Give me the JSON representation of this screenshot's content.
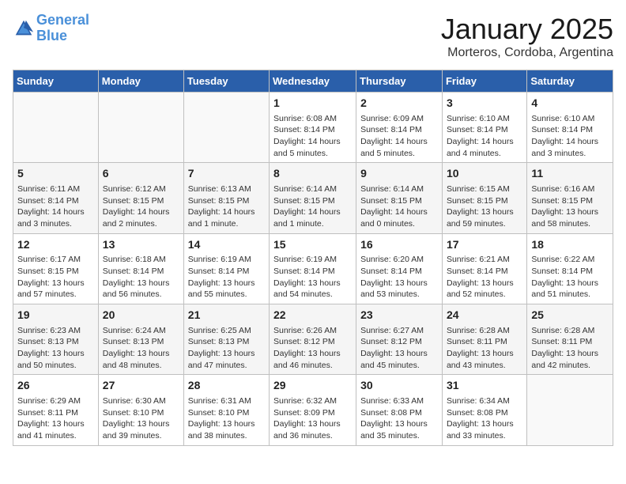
{
  "logo": {
    "line1": "General",
    "line2": "Blue"
  },
  "title": "January 2025",
  "subtitle": "Morteros, Cordoba, Argentina",
  "days_header": [
    "Sunday",
    "Monday",
    "Tuesday",
    "Wednesday",
    "Thursday",
    "Friday",
    "Saturday"
  ],
  "weeks": [
    [
      {
        "day": "",
        "info": ""
      },
      {
        "day": "",
        "info": ""
      },
      {
        "day": "",
        "info": ""
      },
      {
        "day": "1",
        "info": "Sunrise: 6:08 AM\nSunset: 8:14 PM\nDaylight: 14 hours\nand 5 minutes."
      },
      {
        "day": "2",
        "info": "Sunrise: 6:09 AM\nSunset: 8:14 PM\nDaylight: 14 hours\nand 5 minutes."
      },
      {
        "day": "3",
        "info": "Sunrise: 6:10 AM\nSunset: 8:14 PM\nDaylight: 14 hours\nand 4 minutes."
      },
      {
        "day": "4",
        "info": "Sunrise: 6:10 AM\nSunset: 8:14 PM\nDaylight: 14 hours\nand 3 minutes."
      }
    ],
    [
      {
        "day": "5",
        "info": "Sunrise: 6:11 AM\nSunset: 8:14 PM\nDaylight: 14 hours\nand 3 minutes."
      },
      {
        "day": "6",
        "info": "Sunrise: 6:12 AM\nSunset: 8:15 PM\nDaylight: 14 hours\nand 2 minutes."
      },
      {
        "day": "7",
        "info": "Sunrise: 6:13 AM\nSunset: 8:15 PM\nDaylight: 14 hours\nand 1 minute."
      },
      {
        "day": "8",
        "info": "Sunrise: 6:14 AM\nSunset: 8:15 PM\nDaylight: 14 hours\nand 1 minute."
      },
      {
        "day": "9",
        "info": "Sunrise: 6:14 AM\nSunset: 8:15 PM\nDaylight: 14 hours\nand 0 minutes."
      },
      {
        "day": "10",
        "info": "Sunrise: 6:15 AM\nSunset: 8:15 PM\nDaylight: 13 hours\nand 59 minutes."
      },
      {
        "day": "11",
        "info": "Sunrise: 6:16 AM\nSunset: 8:15 PM\nDaylight: 13 hours\nand 58 minutes."
      }
    ],
    [
      {
        "day": "12",
        "info": "Sunrise: 6:17 AM\nSunset: 8:15 PM\nDaylight: 13 hours\nand 57 minutes."
      },
      {
        "day": "13",
        "info": "Sunrise: 6:18 AM\nSunset: 8:14 PM\nDaylight: 13 hours\nand 56 minutes."
      },
      {
        "day": "14",
        "info": "Sunrise: 6:19 AM\nSunset: 8:14 PM\nDaylight: 13 hours\nand 55 minutes."
      },
      {
        "day": "15",
        "info": "Sunrise: 6:19 AM\nSunset: 8:14 PM\nDaylight: 13 hours\nand 54 minutes."
      },
      {
        "day": "16",
        "info": "Sunrise: 6:20 AM\nSunset: 8:14 PM\nDaylight: 13 hours\nand 53 minutes."
      },
      {
        "day": "17",
        "info": "Sunrise: 6:21 AM\nSunset: 8:14 PM\nDaylight: 13 hours\nand 52 minutes."
      },
      {
        "day": "18",
        "info": "Sunrise: 6:22 AM\nSunset: 8:14 PM\nDaylight: 13 hours\nand 51 minutes."
      }
    ],
    [
      {
        "day": "19",
        "info": "Sunrise: 6:23 AM\nSunset: 8:13 PM\nDaylight: 13 hours\nand 50 minutes."
      },
      {
        "day": "20",
        "info": "Sunrise: 6:24 AM\nSunset: 8:13 PM\nDaylight: 13 hours\nand 48 minutes."
      },
      {
        "day": "21",
        "info": "Sunrise: 6:25 AM\nSunset: 8:13 PM\nDaylight: 13 hours\nand 47 minutes."
      },
      {
        "day": "22",
        "info": "Sunrise: 6:26 AM\nSunset: 8:12 PM\nDaylight: 13 hours\nand 46 minutes."
      },
      {
        "day": "23",
        "info": "Sunrise: 6:27 AM\nSunset: 8:12 PM\nDaylight: 13 hours\nand 45 minutes."
      },
      {
        "day": "24",
        "info": "Sunrise: 6:28 AM\nSunset: 8:11 PM\nDaylight: 13 hours\nand 43 minutes."
      },
      {
        "day": "25",
        "info": "Sunrise: 6:28 AM\nSunset: 8:11 PM\nDaylight: 13 hours\nand 42 minutes."
      }
    ],
    [
      {
        "day": "26",
        "info": "Sunrise: 6:29 AM\nSunset: 8:11 PM\nDaylight: 13 hours\nand 41 minutes."
      },
      {
        "day": "27",
        "info": "Sunrise: 6:30 AM\nSunset: 8:10 PM\nDaylight: 13 hours\nand 39 minutes."
      },
      {
        "day": "28",
        "info": "Sunrise: 6:31 AM\nSunset: 8:10 PM\nDaylight: 13 hours\nand 38 minutes."
      },
      {
        "day": "29",
        "info": "Sunrise: 6:32 AM\nSunset: 8:09 PM\nDaylight: 13 hours\nand 36 minutes."
      },
      {
        "day": "30",
        "info": "Sunrise: 6:33 AM\nSunset: 8:08 PM\nDaylight: 13 hours\nand 35 minutes."
      },
      {
        "day": "31",
        "info": "Sunrise: 6:34 AM\nSunset: 8:08 PM\nDaylight: 13 hours\nand 33 minutes."
      },
      {
        "day": "",
        "info": ""
      }
    ]
  ]
}
